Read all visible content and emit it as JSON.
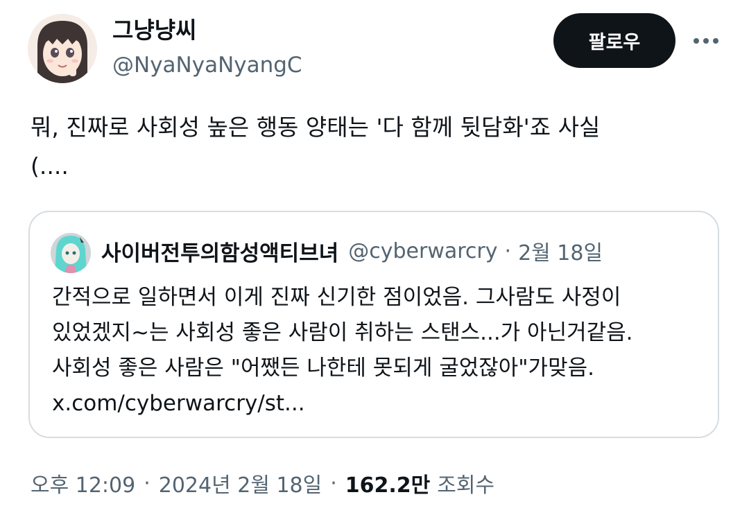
{
  "author": {
    "display_name": "그냥냥씨",
    "handle": "@NyaNyaNyangC",
    "avatar": "anime-girl-avatar-icon"
  },
  "follow_button": {
    "label": "팔로우"
  },
  "more_icon": "more-horizontal-icon",
  "tweet": {
    "text": "뭐, 진짜로 사회성 높은 행동 양태는 '다 함께 뒷담화'죠 사실\n(...."
  },
  "quote": {
    "author_name": "사이버전투의함성액티브녀",
    "author_handle": "@cyberwarcry",
    "separator": "·",
    "date": "2월 18일",
    "avatar": "cyan-haired-character-avatar-icon",
    "lines": [
      "간적으로 일하면서 이게 진짜 신기한 점이었음. 그사람도 사정이",
      "있었겠지~는 사회성 좋은 사람이 취하는 스탠스...가 아닌거같음.",
      "사회성 좋은 사람은 \"어쨌든 나한테 못되게 굴었잖아\"가맞음.",
      "x.com/cyberwarcry/st..."
    ]
  },
  "meta": {
    "time": "오후 12:09",
    "separator": "·",
    "date": "2024년 2월 18일",
    "views_count": "162.2만",
    "views_label": "조회수"
  },
  "colors": {
    "text_primary": "#0f1419",
    "text_secondary": "#536471",
    "border": "#d6dce0",
    "button_bg": "#0f1419",
    "button_text": "#ffffff"
  }
}
